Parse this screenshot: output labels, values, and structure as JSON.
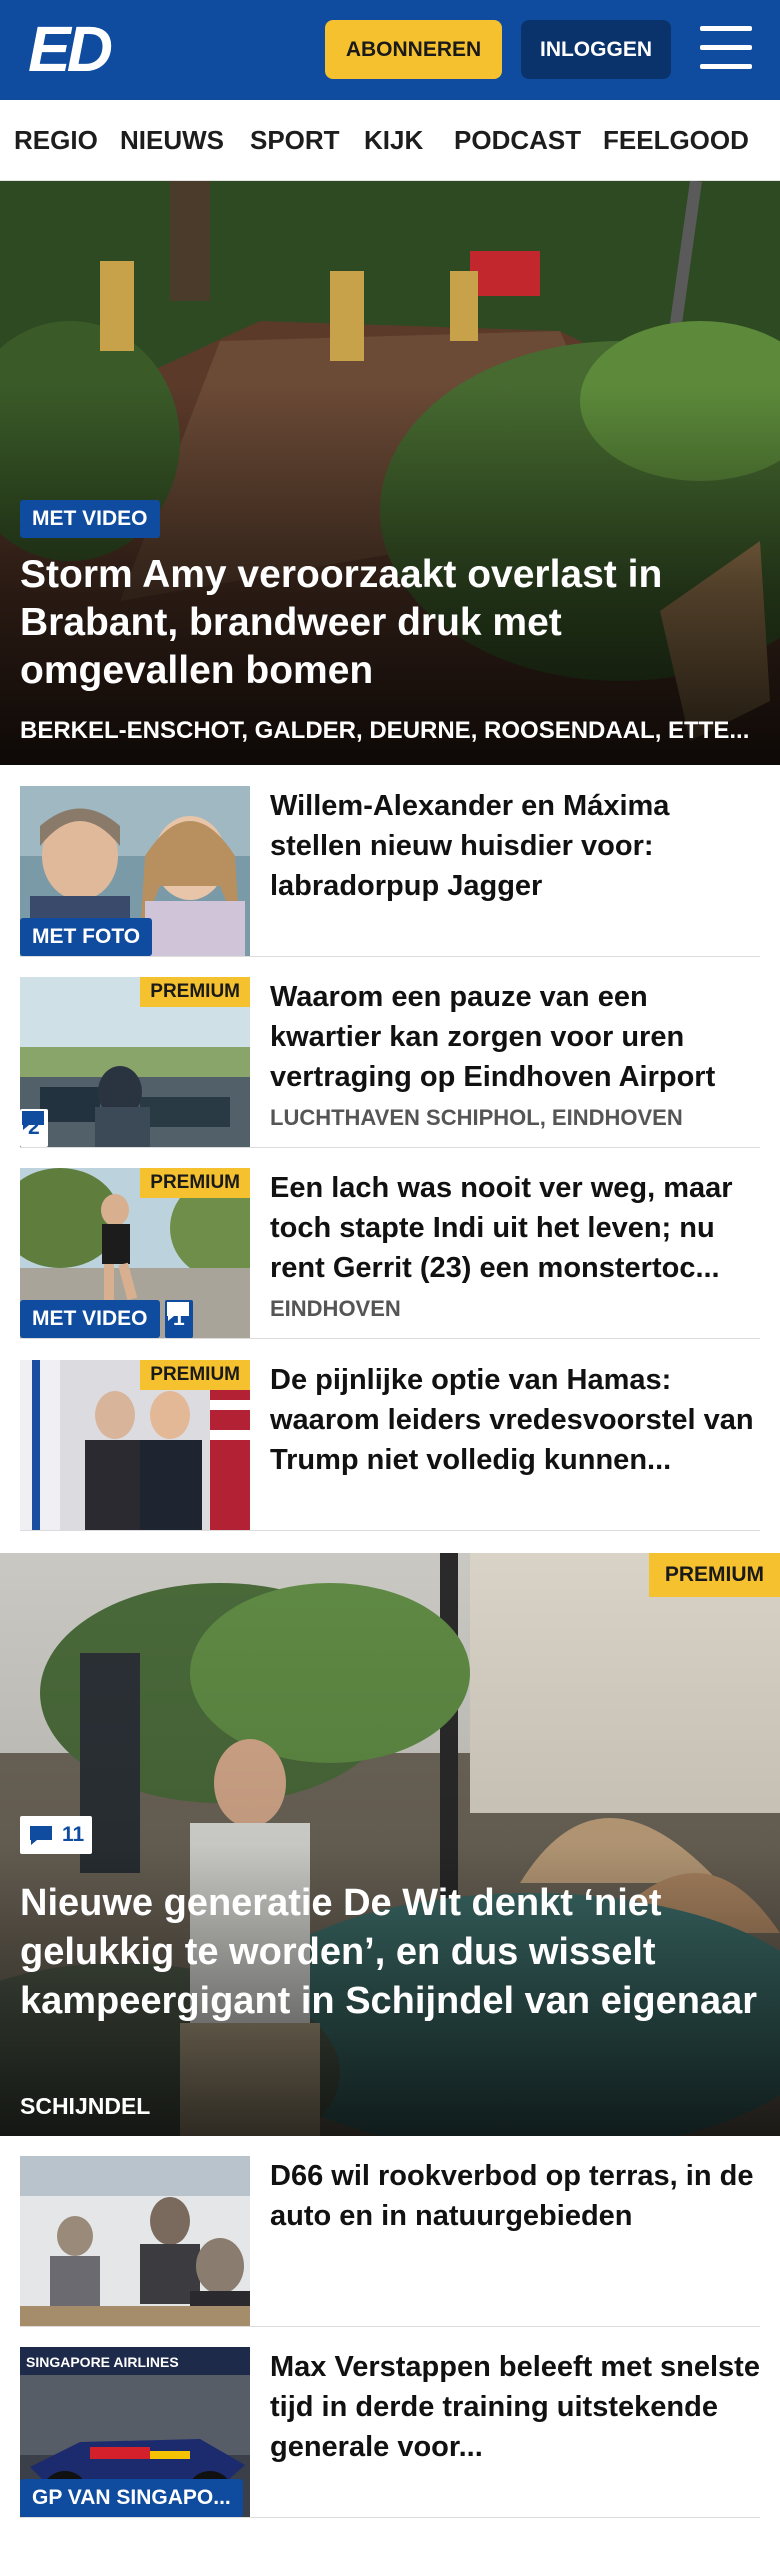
{
  "header": {
    "logo_text": "ED",
    "subscribe_label": "ABONNEREN",
    "login_label": "INLOGGEN",
    "brand_color": "#0f4b9e",
    "accent_color": "#f6c12e"
  },
  "nav": {
    "items": [
      "REGIO",
      "NIEUWS",
      "SPORT",
      "KIJK",
      "PODCAST",
      "FEELGOOD"
    ]
  },
  "hero": {
    "badge": "MET VIDEO",
    "title": "Storm Amy veroorzaakt overlast in Brabant, brandweer druk met omgevallen bomen",
    "locations": "BERKEL-ENSCHOT, GALDER, DEURNE, ROOSENDAAL, ETTE..."
  },
  "articles": [
    {
      "title": "Willem-Alexander en Máxima stellen nieuw huisdier voor: labradorpup Jagger",
      "badge": "MET FOTO"
    },
    {
      "title": "Waarom een pauze van een kwartier kan zorgen voor uren vertraging op Eindhoven Airport",
      "premium": "PREMIUM",
      "comments": "2",
      "location": "LUCHTHAVEN SCHIPHOL, EINDHOVEN"
    },
    {
      "title": "Een lach was nooit ver weg, maar toch stapte Indi uit het leven; nu rent Gerrit (23) een monstertoc...",
      "premium": "PREMIUM",
      "badge": "MET VIDEO",
      "comments": "1",
      "location": "EINDHOVEN"
    },
    {
      "title": "De pijnlijke optie van Hamas: waarom leiders vredesvoorstel van Trump niet volledig kunnen...",
      "premium": "PREMIUM"
    }
  ],
  "feature": {
    "premium": "PREMIUM",
    "comments": "11",
    "title": "Nieuwe generatie De Wit denkt ‘niet gelukkig te worden’, en dus wisselt kampeergigant in Schijndel van eigenaar",
    "location": "SCHIJNDEL"
  },
  "more_articles": [
    {
      "title": "D66 wil rookverbod op terras, in de auto en in natuurgebieden"
    },
    {
      "title": "Max Verstappen beleeft met snelste tijd in derde training uitstekende generale voor...",
      "badge": "GP VAN SINGAPO...",
      "image_text": "SINGAPORE AIRLINES"
    }
  ]
}
